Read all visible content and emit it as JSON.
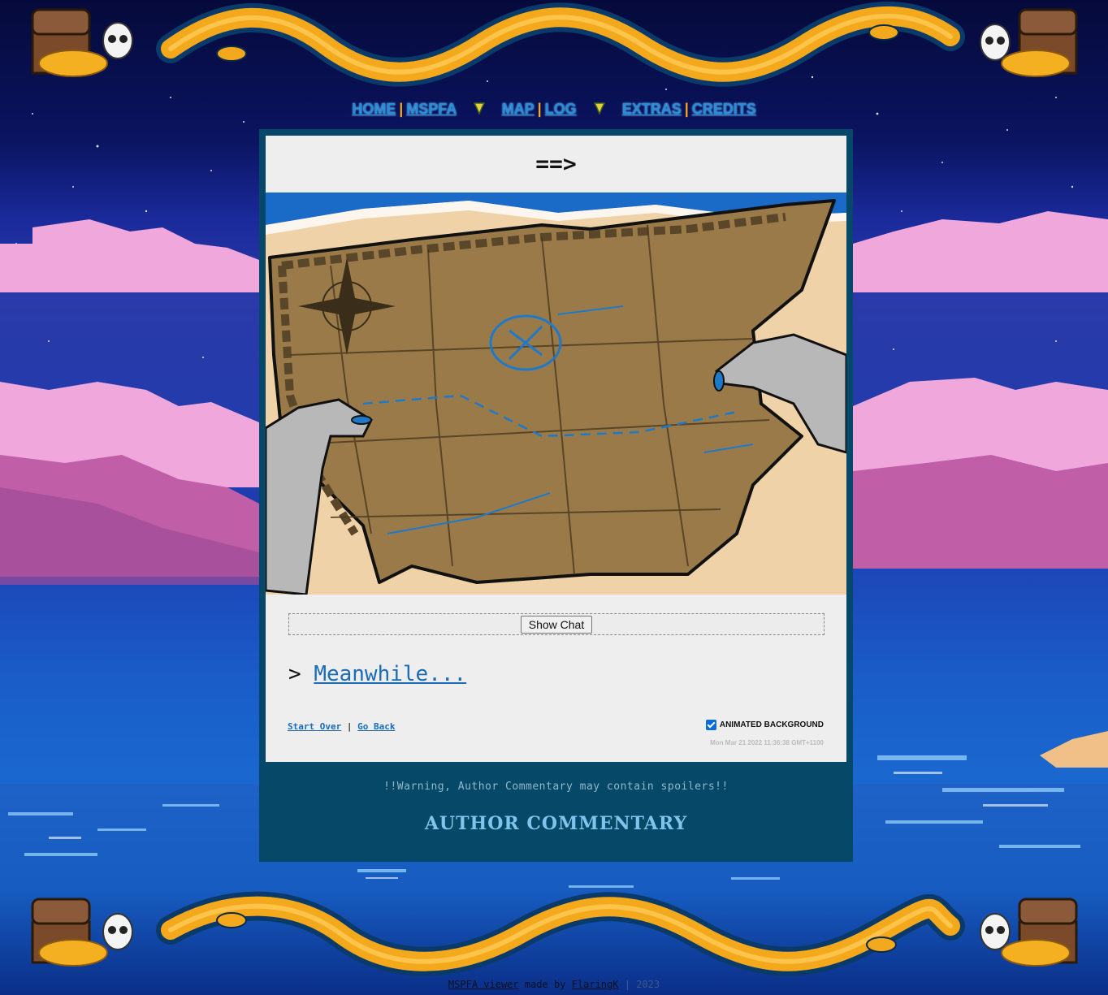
{
  "nav": {
    "items": [
      {
        "label": "HOME"
      },
      {
        "label": "MSPFA"
      },
      {
        "label": "MAP"
      },
      {
        "label": "LOG"
      },
      {
        "label": "EXTRAS"
      },
      {
        "label": "CREDITS"
      }
    ],
    "separator": "|"
  },
  "page": {
    "command": "==>",
    "show_chat_label": "Show Chat",
    "next_prefix": ">",
    "next_link": "Meanwhile...",
    "start_over": "Start Over",
    "link_separator": "|",
    "go_back": "Go Back",
    "animated_bg_label": "ANIMATED BACKGROUND",
    "animated_bg_checked": true,
    "timestamp": "Mon Mar 21 2022 11:36:38 GMT+1100"
  },
  "commentary": {
    "warning": "!!Warning, Author Commentary may contain spoilers!!",
    "heading": "AUTHOR COMMENTARY"
  },
  "footer": {
    "viewer_link": "MSPFA viewer",
    "made_by": "made by",
    "author_link": "FlaringK",
    "separator": "|",
    "year": "2023"
  },
  "colors": {
    "frame": "#064868",
    "panel_bg": "#eeeeee",
    "link": "#1a6cb8",
    "nav_separator": "#f4a81c",
    "commentary": "#7fc4ec"
  },
  "icons": [
    "treasure-chest-icon",
    "skull-icon",
    "sea-serpent-icon",
    "gem-icon",
    "checkbox-icon"
  ]
}
